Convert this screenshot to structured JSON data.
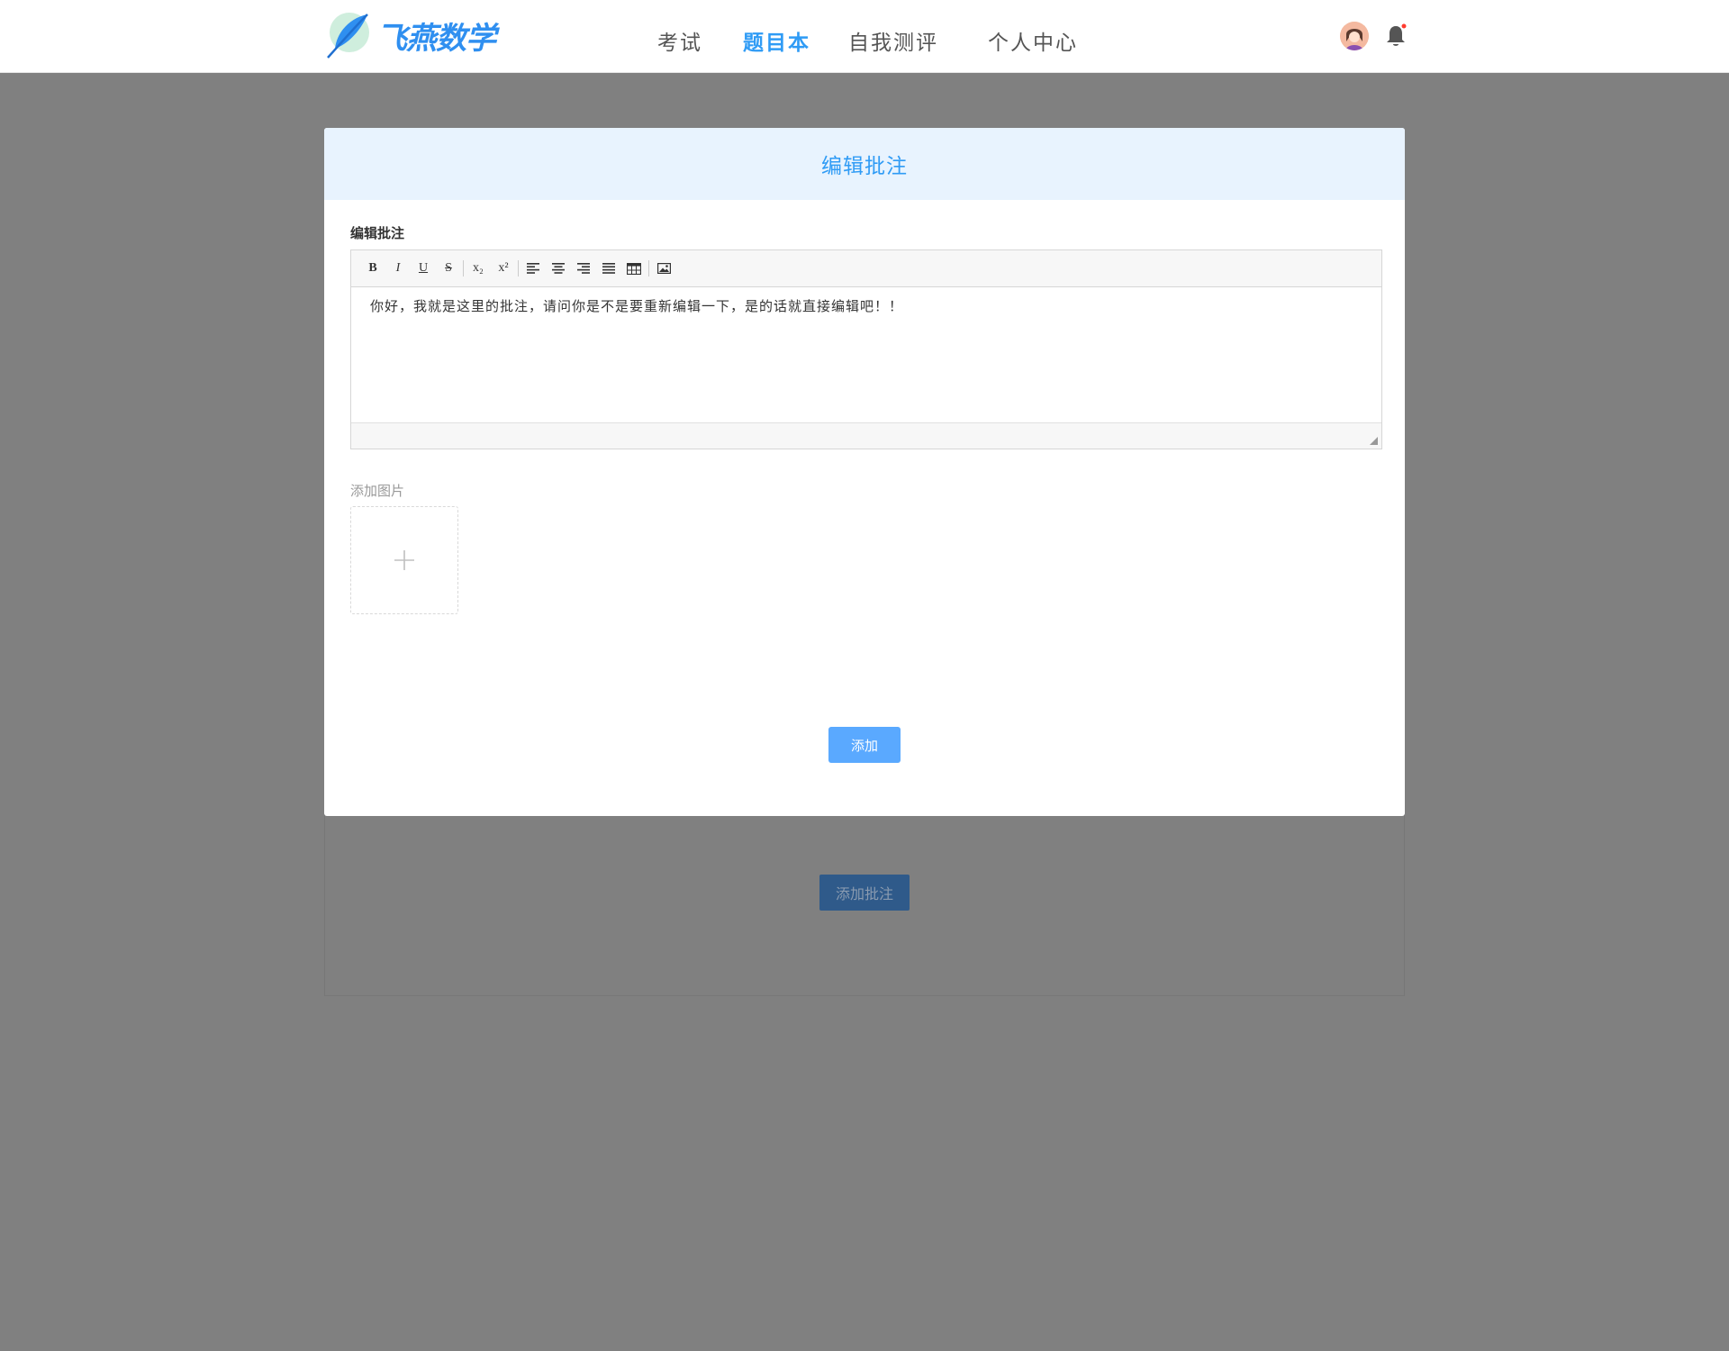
{
  "header": {
    "logo_text": "飞燕数学",
    "nav": [
      {
        "label": "考试",
        "active": false
      },
      {
        "label": "题目本",
        "active": true
      },
      {
        "label": "自我测评",
        "active": false
      },
      {
        "label": "个人中心",
        "active": false
      }
    ],
    "icons": {
      "avatar": "user-avatar",
      "bell": "bell-icon"
    },
    "colors": {
      "accent": "#2f9bf5",
      "notification_dot": "#ff3b30"
    }
  },
  "background": {
    "add_annotation_button": "添加批注"
  },
  "modal": {
    "title": "编辑批注",
    "field_label": "编辑批注",
    "toolbar": [
      "B",
      "I",
      "U",
      "S",
      "x₂",
      "x²",
      "align-left",
      "align-center",
      "align-right",
      "align-justify",
      "table",
      "image"
    ],
    "content": "你好，我就是这里的批注，请问你是不是要重新编辑一下，是的话就直接编辑吧！！",
    "image_label": "添加图片",
    "upload_icon": "plus-icon",
    "submit_button": "添加"
  }
}
